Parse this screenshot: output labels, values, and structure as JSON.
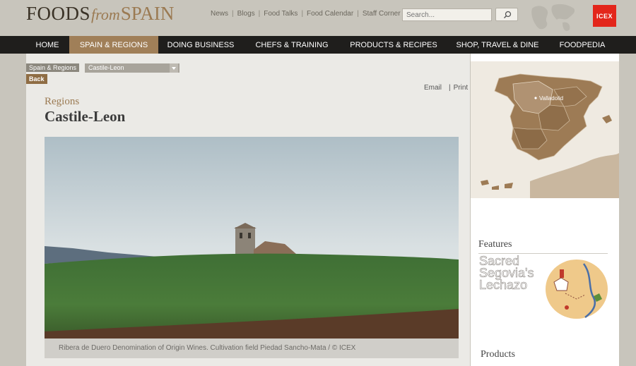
{
  "logo": {
    "part1": "FOODS",
    "part2": "from",
    "part3": "SPAIN"
  },
  "top_links": [
    "News",
    "Blogs",
    "Food Talks",
    "Food Calendar",
    "Staff Corner"
  ],
  "search": {
    "placeholder": "Search..."
  },
  "icex": "ICEX",
  "nav": [
    "HOME",
    "SPAIN & REGIONS",
    "DOING BUSINESS",
    "CHEFS & TRAINING",
    "PRODUCTS & RECIPES",
    "SHOP, TRAVEL & DINE",
    "FOODPEDIA"
  ],
  "breadcrumb": {
    "section": "Spain & Regions",
    "selected": "Castile-Leon",
    "back": "Back"
  },
  "tools": {
    "email": "Email",
    "print": "Print"
  },
  "page": {
    "kicker": "Regions",
    "title": "Castile-Leon"
  },
  "photo_caption": "Ribera de Duero Denomination of Origin Wines. Cultivation field Piedad Sancho-Mata / © ICEX",
  "map_label": "Valladolid",
  "sidebar": {
    "features_heading": "Features",
    "feature_title": "Sacred Segovia's Lechazo",
    "products_heading": "Products"
  },
  "colors": {
    "accent": "#a07f58",
    "nav_bg": "#1f1e1c",
    "icex_red": "#e3261b"
  }
}
